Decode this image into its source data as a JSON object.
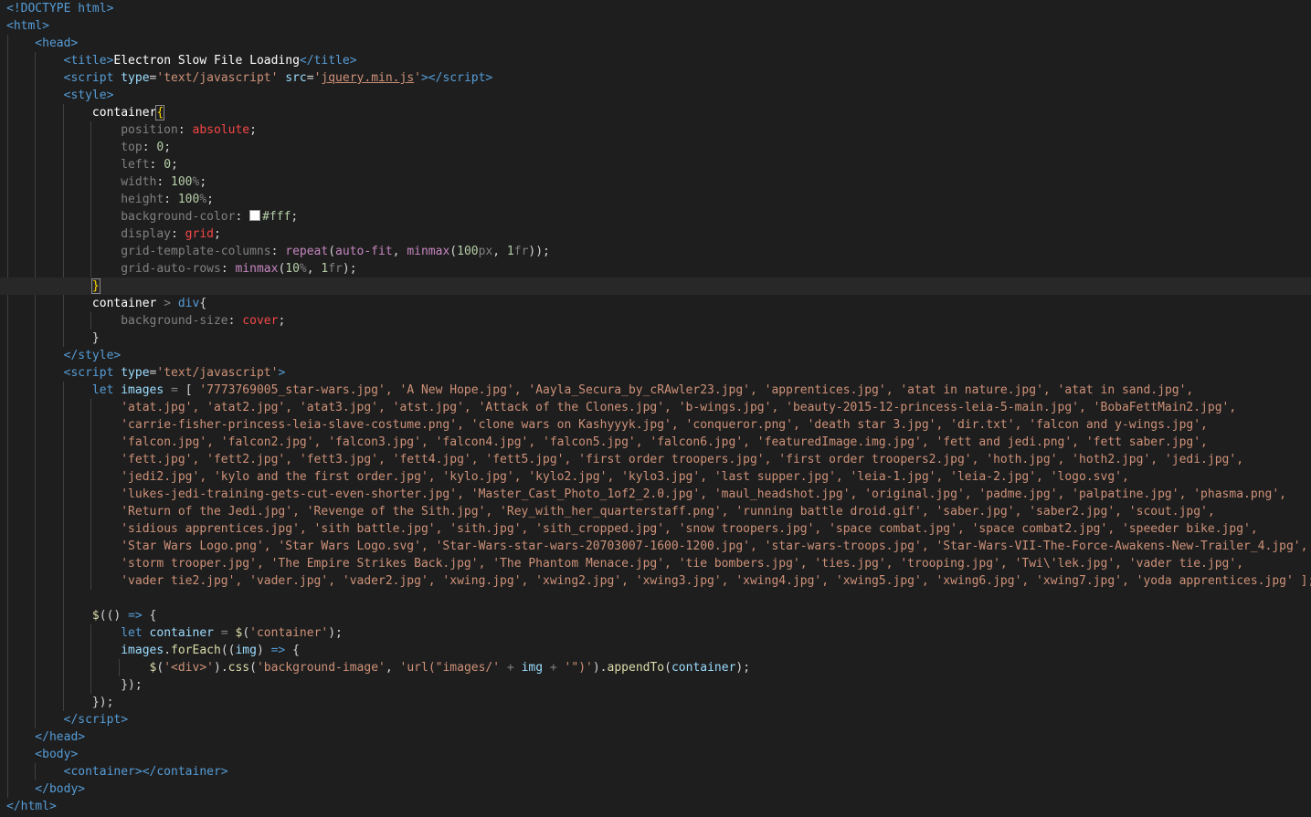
{
  "editor": {
    "colors": {
      "background": "#1e1e1e",
      "tag": "#569cd6",
      "attribute": "#9cdcfe",
      "string": "#ce9178",
      "number": "#b5cea8",
      "function": "#dcdcaa",
      "css_value": "#f44747"
    },
    "code": {
      "doctype": "<!DOCTYPE html>",
      "title_text": "Electron Slow File Loading",
      "jquery_src": "jquery.min.js",
      "script_type": "'text/javascript'",
      "css": {
        "selector1": "container",
        "position": "absolute",
        "top": "0",
        "left": "0",
        "width": "100",
        "height": "100",
        "bg_color": "#fff",
        "display": "grid",
        "grid_cols_px": "100",
        "grid_rows_pct": "10",
        "selector2_a": "container",
        "selector2_b": "div",
        "bg_size": "cover"
      },
      "images_lines": [
        "'7773769005_star-wars.jpg', 'A New Hope.jpg', 'Aayla_Secura_by_cRAwler23.jpg', 'apprentices.jpg', 'atat in nature.jpg', 'atat in sand.jpg',",
        "'atat.jpg', 'atat2.jpg', 'atat3.jpg', 'atst.jpg', 'Attack of the Clones.jpg', 'b-wings.jpg', 'beauty-2015-12-princess-leia-5-main.jpg', 'BobaFettMain2.jpg',",
        "'carrie-fisher-princess-leia-slave-costume.png', 'clone wars on Kashyyyk.jpg', 'conqueror.png', 'death star 3.jpg', 'dir.txt', 'falcon and y-wings.jpg',",
        "'falcon.jpg', 'falcon2.jpg', 'falcon3.jpg', 'falcon4.jpg', 'falcon5.jpg', 'falcon6.jpg', 'featuredImage.img.jpg', 'fett and jedi.png', 'fett saber.jpg',",
        "'fett.jpg', 'fett2.jpg', 'fett3.jpg', 'fett4.jpg', 'fett5.jpg', 'first order troopers.jpg', 'first order troopers2.jpg', 'hoth.jpg', 'hoth2.jpg', 'jedi.jpg',",
        "'jedi2.jpg', 'kylo and the first order.jpg', 'kylo.jpg', 'kylo2.jpg', 'kylo3.jpg', 'last supper.jpg', 'leia-1.jpg', 'leia-2.jpg', 'logo.svg',",
        "'lukes-jedi-training-gets-cut-even-shorter.jpg', 'Master_Cast_Photo_1of2_2.0.jpg', 'maul_headshot.jpg', 'original.jpg', 'padme.jpg', 'palpatine.jpg', 'phasma.png',",
        "'Return of the Jedi.jpg', 'Revenge of the Sith.jpg', 'Rey_with_her_quarterstaff.png', 'running battle droid.gif', 'saber.jpg', 'saber2.jpg', 'scout.jpg',",
        "'sidious apprentices.jpg', 'sith battle.jpg', 'sith.jpg', 'sith_cropped.jpg', 'snow troopers.jpg', 'space combat.jpg', 'space combat2.jpg', 'speeder bike.jpg',",
        "'Star Wars Logo.png', 'Star Wars Logo.svg', 'Star-Wars-star-wars-20703007-1600-1200.jpg', 'star-wars-troops.jpg', 'Star-Wars-VII-The-Force-Awakens-New-Trailer_4.jpg',",
        "'storm trooper.jpg', 'The Empire Strikes Back.jpg', 'The Phantom Menace.jpg', 'tie bombers.jpg', 'ties.jpg', 'trooping.jpg', 'Twi\\'lek.jpg', 'vader tie.jpg',",
        "'vader tie2.jpg', 'vader.jpg', 'vader2.jpg', 'xwing.jpg', 'xwing2.jpg', 'xwing3.jpg', 'xwing4.jpg', 'xwing5.jpg', 'xwing6.jpg', 'xwing7.jpg', 'yoda apprentices.jpg' ];"
      ],
      "js": {
        "container_selector": "'container'",
        "div_string": "'<div>'",
        "bg_image_prop": "'background-image'",
        "url_prefix": "'url(\"images/'",
        "url_suffix": "'\")'"
      }
    }
  }
}
